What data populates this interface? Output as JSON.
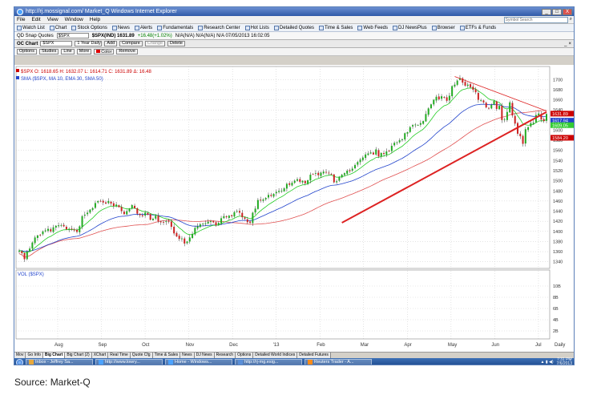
{
  "window": {
    "title": "http://rj.mossignal.com/  Market_Q  Windows Internet Explorer",
    "controls": [
      "_",
      "□",
      "X"
    ]
  },
  "menu": {
    "items": [
      "File",
      "Edit",
      "View",
      "Window",
      "Help"
    ],
    "search_placeholder": "Symbol Search"
  },
  "toolbar": {
    "items": [
      "Watch List",
      "Chart",
      "Stock Options",
      "News",
      "Alerts",
      "Fundamentals",
      "Research Center",
      "Hot Lists",
      "Detailed Quotes",
      "Time & Sales",
      "Web Feeds",
      "DJ NewsPlus",
      "Browser",
      "ETFs & Funds"
    ]
  },
  "quote": {
    "label": "QD Snap Quotes",
    "symbol": "$SPX",
    "text": "$SPX(IND) 1631.89",
    "change": "+16.48(+1.02%)",
    "rest": "N/A(N/A)  N/A(N/A)  N/A  07/05/2013 16:02:05"
  },
  "chartbar": {
    "label": "OC Chart",
    "symbol": "$SPX",
    "period": "1 Year Daily",
    "buttons": [
      "Add",
      "Compare",
      "Change",
      "Delete"
    ]
  },
  "studybar": {
    "buttons": [
      "Options",
      "Studies",
      "Line",
      "More",
      "Color",
      "Remove"
    ]
  },
  "chart_data": {
    "type": "candlestick",
    "price_legend": "$SPX  O: 1618.65  H: 1632.07  L: 1614.71  C: 1631.89  Δ: 16.48",
    "ma_legend": "SMA ($SPX, MA 10, EMA 30, SMA 50)",
    "volume_legend": "VOL ($SPX)",
    "x_ticks": [
      "Aug",
      "Sep",
      "Oct",
      "Nov",
      "Dec",
      "'13",
      "Feb",
      "Mar",
      "Apr",
      "May",
      "Jun",
      "Jul"
    ],
    "x_axis_label": "Daily",
    "y_ticks": [
      1700,
      1680,
      1660,
      1640,
      1620,
      1600,
      1580,
      1560,
      1540,
      1520,
      1500,
      1480,
      1460,
      1440,
      1420,
      1400,
      1380,
      1360,
      1340
    ],
    "ylim": [
      1330,
      1710
    ],
    "volume_ticks": [
      "10B",
      "8B",
      "6B",
      "4B",
      "2B"
    ],
    "price_tags": [
      {
        "text": "1631.89",
        "value": 1631.89,
        "color": "#cc0000"
      },
      {
        "text": "1617.94",
        "value": 1617.94,
        "color": "#2244cc"
      },
      {
        "text": "1609.05",
        "value": 1609.05,
        "color": "#33cc33"
      },
      {
        "text": "1584.20",
        "value": 1584.2,
        "color": "#cc0000"
      }
    ],
    "close_series": [
      1362,
      1357,
      1345,
      1360,
      1366,
      1378,
      1388,
      1392,
      1393,
      1400,
      1402,
      1405,
      1400,
      1408,
      1411,
      1412,
      1412,
      1410,
      1404,
      1405,
      1404,
      1402,
      1399,
      1410,
      1430,
      1433,
      1437,
      1443,
      1446,
      1456,
      1460,
      1459,
      1457,
      1455,
      1460,
      1455,
      1450,
      1453,
      1448,
      1440,
      1434,
      1440,
      1444,
      1452,
      1446,
      1435,
      1432,
      1430,
      1437,
      1433,
      1423,
      1425,
      1431,
      1420,
      1418,
      1418,
      1420,
      1419,
      1409,
      1396,
      1390,
      1385,
      1386,
      1376,
      1380,
      1388,
      1395,
      1407,
      1410,
      1414,
      1415,
      1416,
      1419,
      1420,
      1418,
      1412,
      1417,
      1426,
      1430,
      1428,
      1431,
      1430,
      1438,
      1440,
      1437,
      1428,
      1425,
      1418,
      1417,
      1437,
      1445,
      1462,
      1461,
      1463,
      1466,
      1472,
      1470,
      1474,
      1478,
      1480,
      1480,
      1485,
      1494,
      1492,
      1496,
      1500,
      1503,
      1498,
      1500,
      1495,
      1501,
      1512,
      1513,
      1515,
      1511,
      1516,
      1518,
      1517,
      1515,
      1513,
      1497,
      1499,
      1508,
      1512,
      1515,
      1520,
      1519,
      1524,
      1531,
      1537,
      1542,
      1546,
      1552,
      1554,
      1556,
      1552,
      1562,
      1548,
      1555,
      1553,
      1558,
      1559,
      1569,
      1575,
      1576,
      1580,
      1582,
      1594,
      1596,
      1606,
      1610,
      1611,
      1610,
      1614,
      1618,
      1632,
      1643,
      1651,
      1660,
      1666,
      1661,
      1667,
      1665,
      1658,
      1668,
      1687,
      1690,
      1698,
      1703,
      1694,
      1688,
      1690,
      1685,
      1680,
      1675,
      1660,
      1659,
      1655,
      1645,
      1643,
      1650,
      1658,
      1642,
      1648,
      1620,
      1621,
      1636,
      1655,
      1629,
      1613,
      1593,
      1588,
      1573,
      1602,
      1606,
      1614,
      1615,
      1630,
      1633,
      1621,
      1618,
      1632
    ],
    "ema10": [],
    "ema30": [],
    "sma50": []
  },
  "tabs": {
    "items": [
      "Mov",
      "Go Info",
      "Big Chart",
      "Big Chart (2)",
      "XChart",
      "Real Time",
      "Quote Cfg",
      "Time & Sales",
      "News",
      "DJ News",
      "Research",
      "Options",
      "Detailed World Indices",
      "Detailed Futures"
    ],
    "active": 2
  },
  "taskbar": {
    "items": [
      {
        "label": "Inbox - Jeffrey Sa...",
        "color": "#e8a93c"
      },
      {
        "label": "http://www.lowry...",
        "color": "#4ca3ff"
      },
      {
        "label": "Home - Windows...",
        "color": "#4ca3ff"
      },
      {
        "label": "http://rj-mg.esig...",
        "color": "#5a8fd8"
      },
      {
        "label": "Reuters Trader - A...",
        "color": "#ff8c1a"
      }
    ],
    "time": "7:31 PM",
    "date": "7/6/2013"
  },
  "caption": "Source:  Market-Q"
}
